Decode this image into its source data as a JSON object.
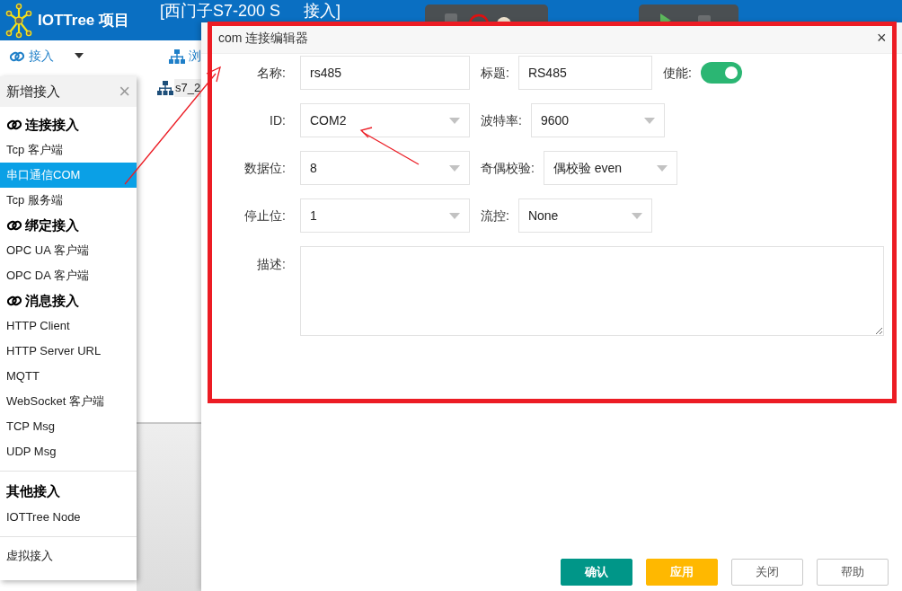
{
  "header": {
    "logo_text": "IOTTree 项目",
    "title_parts": [
      "[西门子S7-200 S",
      "接入]"
    ]
  },
  "toolbar": {
    "connect": "接入",
    "browse": "浏"
  },
  "tree": {
    "item": "s7_2"
  },
  "menu": {
    "title": "新增接入",
    "close": "×",
    "groups": [
      {
        "kind": "linked",
        "title": "连接接入",
        "items": [
          {
            "label": "Tcp 客户端",
            "selected": false
          },
          {
            "label": "串口通信COM",
            "selected": true
          },
          {
            "label": "Tcp 服务端",
            "selected": false
          }
        ]
      },
      {
        "kind": "linked",
        "title": "绑定接入",
        "items": [
          {
            "label": "OPC UA 客户端",
            "selected": false
          },
          {
            "label": "OPC DA 客户端",
            "selected": false
          }
        ]
      },
      {
        "kind": "linked",
        "title": "消息接入",
        "items": [
          {
            "label": "HTTP Client",
            "selected": false
          },
          {
            "label": "HTTP Server URL",
            "selected": false
          },
          {
            "label": "MQTT",
            "selected": false
          },
          {
            "label": "WebSocket 客户端",
            "selected": false
          },
          {
            "label": "TCP Msg",
            "selected": false
          },
          {
            "label": "UDP Msg",
            "selected": false
          }
        ]
      },
      {
        "kind": "plain",
        "title": "其他接入",
        "items": [
          {
            "label": "IOTTree Node",
            "selected": false
          }
        ]
      },
      {
        "kind": "untitled",
        "items": [
          {
            "label": "虚拟接入",
            "selected": false
          }
        ]
      }
    ]
  },
  "dialog": {
    "title": "com 连接编辑器",
    "close": "×",
    "rows": [
      [
        {
          "label": "名称:",
          "kind": "text",
          "value": "rs485"
        },
        {
          "label": "标题:",
          "kind": "text",
          "value": "RS485"
        },
        {
          "label": "使能:",
          "kind": "toggle",
          "on": true
        }
      ],
      [
        {
          "label": "ID:",
          "kind": "select",
          "value": "COM2"
        },
        {
          "label": "波特率:",
          "kind": "select",
          "value": "9600"
        }
      ],
      [
        {
          "label": "数据位:",
          "kind": "select",
          "value": "8"
        },
        {
          "label": "奇偶校验:",
          "kind": "select",
          "value": "偶校验 even"
        }
      ],
      [
        {
          "label": "停止位:",
          "kind": "select",
          "value": "1"
        },
        {
          "label": "流控:",
          "kind": "select",
          "value": "None"
        }
      ],
      [
        {
          "label": "描述:",
          "kind": "textarea"
        }
      ]
    ],
    "buttons": [
      {
        "label": "确认",
        "kind": "primary"
      },
      {
        "label": "应用",
        "kind": "warning"
      },
      {
        "label": "关闭",
        "kind": "default"
      },
      {
        "label": "帮助",
        "kind": "default"
      }
    ]
  }
}
